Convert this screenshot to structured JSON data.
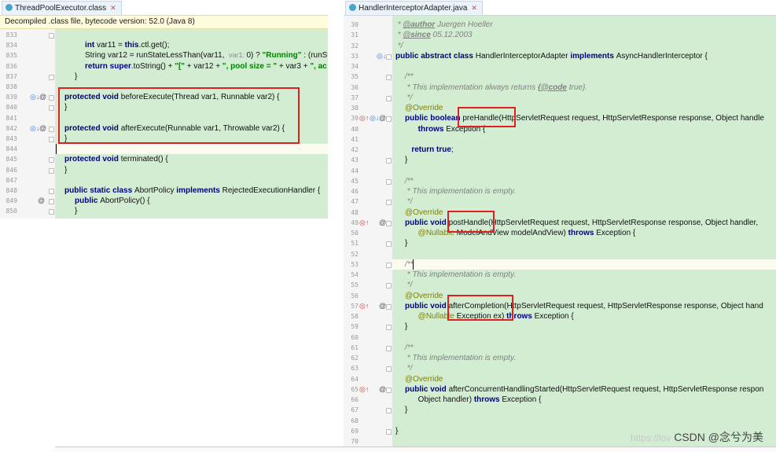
{
  "left_editor": {
    "tab_title": "ThreadPoolExecutor.class",
    "banner": "Decompiled .class file, bytecode version: 52.0 (Java 8)",
    "lines": [
      {
        "num": "833",
        "parts": []
      },
      {
        "num": "834",
        "parts": [
          [
            "kw",
            "int "
          ],
          [
            "t",
            "var11 = "
          ],
          [
            "kw",
            "this"
          ],
          [
            "t",
            ".ctl.get();"
          ]
        ]
      },
      {
        "num": "835",
        "parts": [
          [
            "t",
            "String var12 = runStateLessThan(var11,  "
          ],
          [
            "h",
            "var1: "
          ],
          [
            "t",
            "0) ? "
          ],
          [
            "s",
            "\"Running\""
          ],
          [
            "t",
            " : (runSta"
          ]
        ]
      },
      {
        "num": "836",
        "parts": [
          [
            "kw",
            "return super"
          ],
          [
            "t",
            ".toString() + "
          ],
          [
            "s",
            "\"[\""
          ],
          [
            "t",
            " + var12 + "
          ],
          [
            "s",
            "\", pool size = \""
          ],
          [
            "t",
            " + var3 + "
          ],
          [
            "s",
            "\", ac"
          ]
        ]
      },
      {
        "num": "837",
        "parts": [
          [
            "t",
            "}"
          ]
        ]
      },
      {
        "num": "838",
        "parts": []
      },
      {
        "num": "839",
        "parts": [
          [
            "kw",
            "protected void "
          ],
          [
            "t",
            "beforeExecute(Thread var1, Runnable var2) {"
          ]
        ]
      },
      {
        "num": "840",
        "parts": [
          [
            "t",
            "}"
          ]
        ]
      },
      {
        "num": "841",
        "parts": []
      },
      {
        "num": "842",
        "parts": [
          [
            "kw",
            "protected void "
          ],
          [
            "t",
            "afterExecute(Runnable var1, Throwable var2) {"
          ]
        ]
      },
      {
        "num": "843",
        "parts": [
          [
            "t",
            "}"
          ]
        ]
      },
      {
        "num": "844",
        "parts": []
      },
      {
        "num": "845",
        "parts": [
          [
            "kw",
            "protected void "
          ],
          [
            "t",
            "terminated() {"
          ]
        ]
      },
      {
        "num": "846",
        "parts": [
          [
            "t",
            "}"
          ]
        ]
      },
      {
        "num": "847",
        "parts": []
      },
      {
        "num": "848",
        "parts": [
          [
            "kw",
            "public static class "
          ],
          [
            "t",
            "AbortPolicy "
          ],
          [
            "kw",
            "implements "
          ],
          [
            "t",
            "RejectedExecutionHandler {"
          ]
        ]
      },
      {
        "num": "849",
        "parts": [
          [
            "kw",
            "public "
          ],
          [
            "t",
            "AbortPolicy() {"
          ]
        ]
      },
      {
        "num": "850",
        "parts": [
          [
            "t",
            "}"
          ]
        ]
      }
    ]
  },
  "right_editor": {
    "tab_title": "HandlerInterceptorAdapter.java",
    "lines": [
      {
        "num": "30",
        "parts": [
          [
            "c",
            " * "
          ],
          [
            "cb",
            "@author"
          ],
          [
            "c",
            " Juergen Hoeller"
          ]
        ]
      },
      {
        "num": "31",
        "parts": [
          [
            "c",
            " * "
          ],
          [
            "cb",
            "@since"
          ],
          [
            "c",
            " 05.12.2003"
          ]
        ]
      },
      {
        "num": "32",
        "parts": [
          [
            "c",
            " */"
          ]
        ]
      },
      {
        "num": "33",
        "parts": [
          [
            "kw",
            "public abstract class "
          ],
          [
            "t",
            "HandlerInterceptorAdapter "
          ],
          [
            "kw",
            "implements "
          ],
          [
            "t",
            "AsyncHandlerInterceptor {"
          ]
        ]
      },
      {
        "num": "34",
        "parts": []
      },
      {
        "num": "35",
        "parts": [
          [
            "c",
            "/**"
          ]
        ]
      },
      {
        "num": "36",
        "parts": [
          [
            "c",
            " * This implementation always returns "
          ],
          [
            "cb",
            "{@code"
          ],
          [
            "c",
            " true}."
          ]
        ]
      },
      {
        "num": "37",
        "parts": [
          [
            "c",
            " */"
          ]
        ]
      },
      {
        "num": "38",
        "parts": [
          [
            "a",
            "@Override"
          ]
        ]
      },
      {
        "num": "39",
        "parts": [
          [
            "kw",
            "public boolean "
          ],
          [
            "t",
            "preHandle(HttpServletRequest request, HttpServletResponse response, Object handle"
          ]
        ]
      },
      {
        "num": "40",
        "parts": [
          [
            "t",
            "      "
          ],
          [
            "kw",
            "throws "
          ],
          [
            "t",
            "Exception {"
          ]
        ]
      },
      {
        "num": "41",
        "parts": []
      },
      {
        "num": "42",
        "parts": [
          [
            "t",
            "   "
          ],
          [
            "kw",
            "return true"
          ],
          [
            "t",
            ";"
          ]
        ]
      },
      {
        "num": "43",
        "parts": [
          [
            "t",
            "}"
          ]
        ]
      },
      {
        "num": "44",
        "parts": []
      },
      {
        "num": "45",
        "parts": [
          [
            "c",
            "/**"
          ]
        ]
      },
      {
        "num": "46",
        "parts": [
          [
            "c",
            " * This implementation is empty."
          ]
        ]
      },
      {
        "num": "47",
        "parts": [
          [
            "c",
            " */"
          ]
        ]
      },
      {
        "num": "48",
        "parts": [
          [
            "a",
            "@Override"
          ]
        ]
      },
      {
        "num": "49",
        "parts": [
          [
            "kw",
            "public void "
          ],
          [
            "t",
            "postHandle(HttpServletRequest request, HttpServletResponse response, Object handler,"
          ]
        ]
      },
      {
        "num": "50",
        "parts": [
          [
            "t",
            "      "
          ],
          [
            "a",
            "@Nullable "
          ],
          [
            "t",
            "ModelAndView modelAndView) "
          ],
          [
            "kw",
            "throws "
          ],
          [
            "t",
            "Exception {"
          ]
        ]
      },
      {
        "num": "51",
        "parts": [
          [
            "t",
            "}"
          ]
        ]
      },
      {
        "num": "52",
        "parts": []
      },
      {
        "num": "53",
        "parts": [
          [
            "c",
            "/**"
          ]
        ]
      },
      {
        "num": "54",
        "parts": [
          [
            "c",
            " * This implementation is empty."
          ]
        ]
      },
      {
        "num": "55",
        "parts": [
          [
            "c",
            " */"
          ]
        ]
      },
      {
        "num": "56",
        "parts": [
          [
            "a",
            "@Override"
          ]
        ]
      },
      {
        "num": "57",
        "parts": [
          [
            "kw",
            "public void "
          ],
          [
            "t",
            "afterCompletion(HttpServletRequest request, HttpServletResponse response, Object hand"
          ]
        ]
      },
      {
        "num": "58",
        "parts": [
          [
            "t",
            "      "
          ],
          [
            "a",
            "@Nullable "
          ],
          [
            "t",
            "Exception ex) "
          ],
          [
            "kw",
            "throws "
          ],
          [
            "t",
            "Exception {"
          ]
        ]
      },
      {
        "num": "59",
        "parts": [
          [
            "t",
            "}"
          ]
        ]
      },
      {
        "num": "60",
        "parts": []
      },
      {
        "num": "61",
        "parts": [
          [
            "c",
            "/**"
          ]
        ]
      },
      {
        "num": "62",
        "parts": [
          [
            "c",
            " * This implementation is empty."
          ]
        ]
      },
      {
        "num": "63",
        "parts": [
          [
            "c",
            " */"
          ]
        ]
      },
      {
        "num": "64",
        "parts": [
          [
            "a",
            "@Override"
          ]
        ]
      },
      {
        "num": "65",
        "parts": [
          [
            "kw",
            "public void "
          ],
          [
            "t",
            "afterConcurrentHandlingStarted(HttpServletRequest request, HttpServletResponse respon"
          ]
        ]
      },
      {
        "num": "66",
        "parts": [
          [
            "t",
            "      Object handler) "
          ],
          [
            "kw",
            "throws "
          ],
          [
            "t",
            "Exception {"
          ]
        ]
      },
      {
        "num": "67",
        "parts": [
          [
            "t",
            "}"
          ]
        ]
      },
      {
        "num": "68",
        "parts": []
      },
      {
        "num": "69",
        "parts": [
          [
            "t",
            "}"
          ]
        ]
      },
      {
        "num": "70",
        "parts": []
      }
    ]
  },
  "watermark": {
    "url_text": "https://lov",
    "site": "CSDN @念兮为美"
  },
  "colors": {
    "code_bg": "#d3edd3",
    "highlight_box": "#e02020",
    "keyword": "#000080",
    "string": "#008000",
    "comment": "#808080",
    "annotation": "#808000"
  }
}
